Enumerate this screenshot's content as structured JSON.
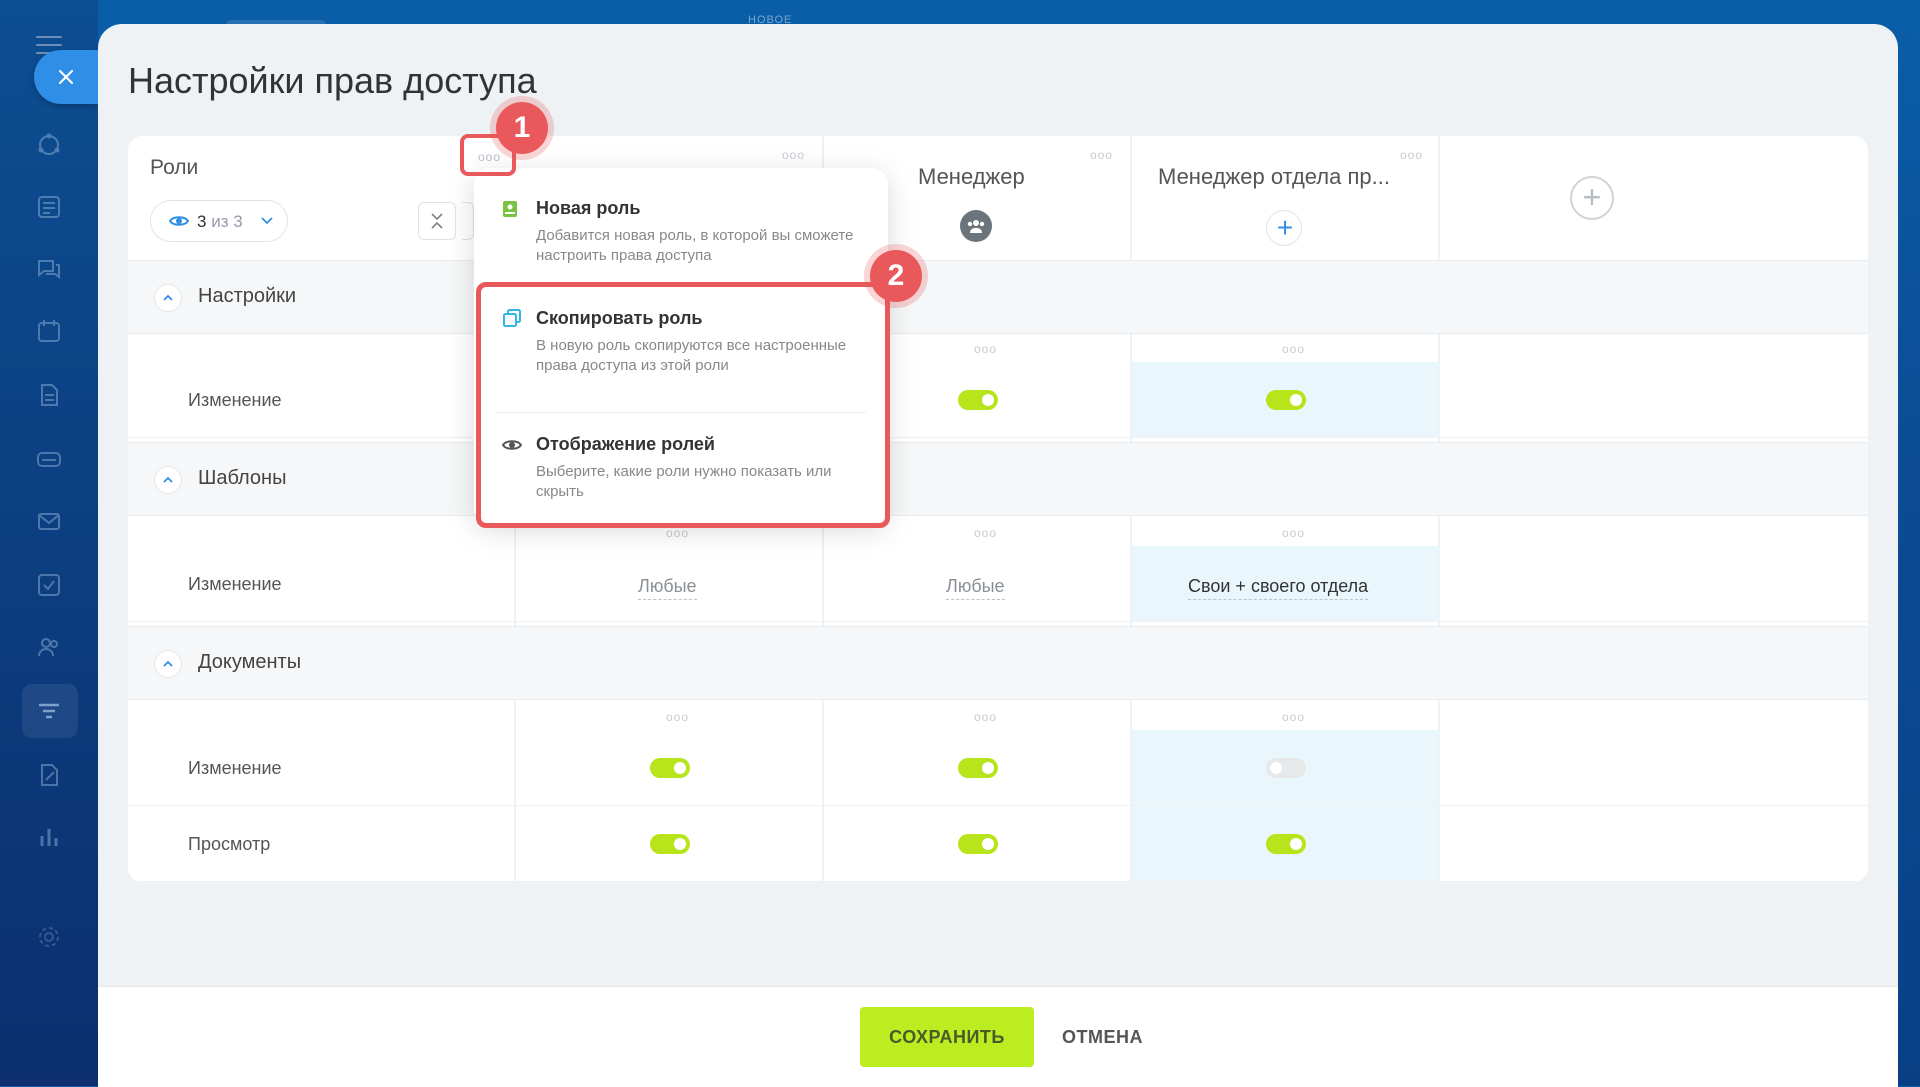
{
  "page": {
    "title": "Настройки прав доступа"
  },
  "top_hint": "НОВОЕ",
  "roles_header": {
    "label": "Роли",
    "visible_count": "3",
    "visible_of": "из 3"
  },
  "roles": [
    {
      "name": "Менеджер"
    },
    {
      "name": "Менеджер отдела пр..."
    }
  ],
  "sections": [
    {
      "title": "Настройки",
      "rows": [
        {
          "label": "Изменение"
        }
      ]
    },
    {
      "title": "Шаблоны",
      "rows": [
        {
          "label": "Изменение",
          "values": [
            "Любые",
            "Любые",
            "Свои + своего отдела"
          ]
        }
      ]
    },
    {
      "title": "Документы",
      "rows": [
        {
          "label": "Изменение"
        },
        {
          "label": "Просмотр"
        }
      ]
    }
  ],
  "dropdown": {
    "items": [
      {
        "title": "Новая роль",
        "desc": "Добавится новая роль, в которой вы сможете настроить права доступа",
        "icon": "new-role-icon"
      },
      {
        "title": "Скопировать роль",
        "desc": "В новую роль скопируются все настроенные права доступа из этой роли",
        "icon": "copy-icon"
      },
      {
        "title": "Отображение ролей",
        "desc": "Выберите, какие роли нужно показать или скрыть",
        "icon": "eye-icon"
      }
    ]
  },
  "annotations": {
    "badge1": "1",
    "badge2": "2"
  },
  "footer": {
    "save_label": "СОХРАНИТЬ",
    "cancel_label": "ОТМЕНА"
  },
  "colors": {
    "accent": "#2f8ee6",
    "toggle_on": "#b7e41b",
    "save_button": "#bbed21",
    "annotation": "#e9585b",
    "highlight_column": "#e9f7fc"
  }
}
